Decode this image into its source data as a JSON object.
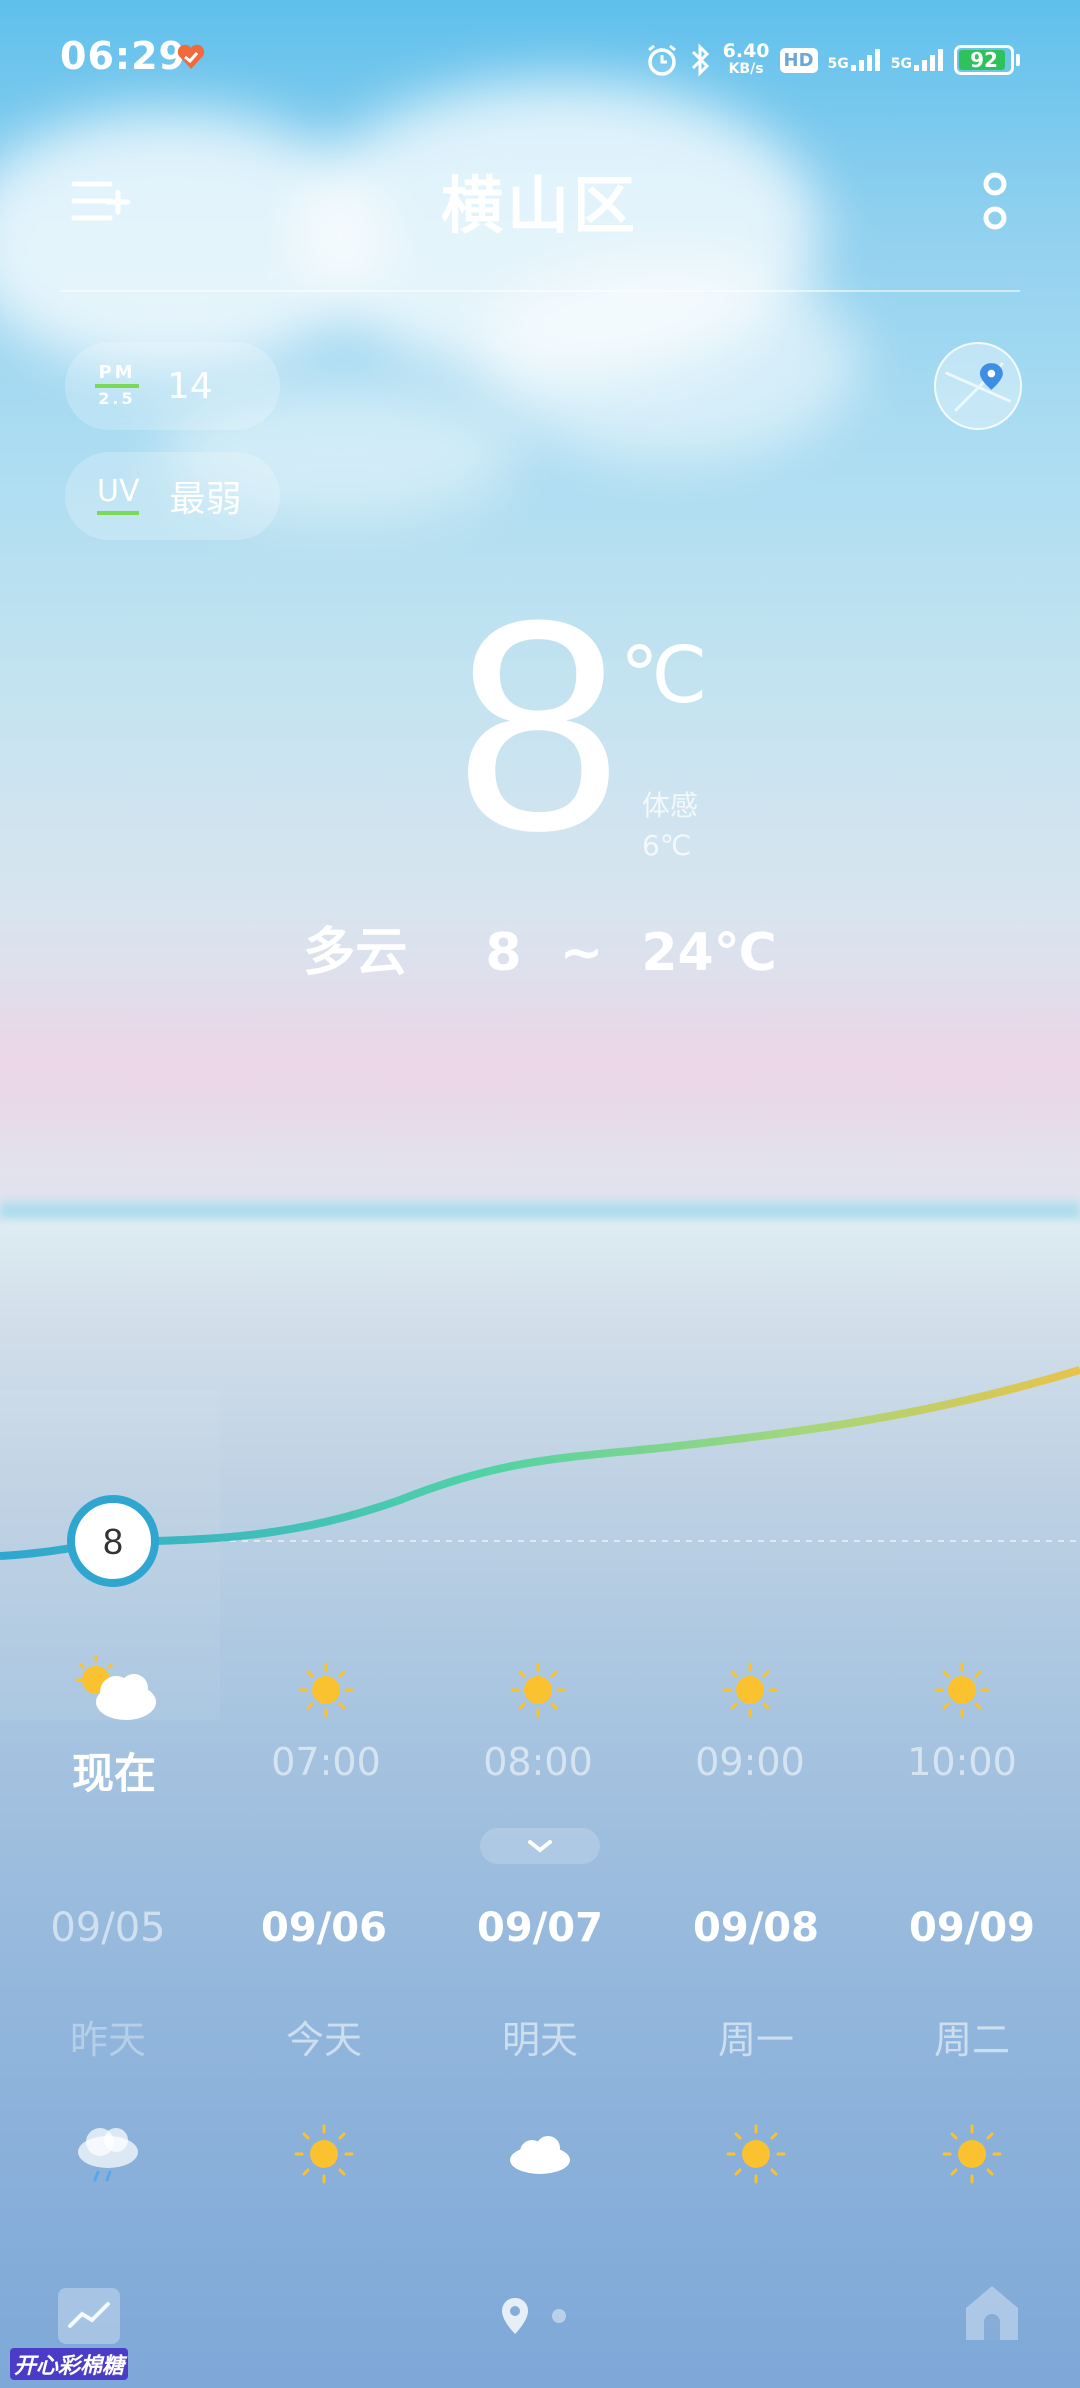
{
  "status_bar": {
    "time": "06:29",
    "net_speed_value": "6.40",
    "net_speed_unit": "KB/s",
    "hd_label": "HD",
    "sim1_label": "5G",
    "sim2_label": "5G",
    "battery": "92",
    "battery_level": 0.92,
    "battery_color": "#2fc25b"
  },
  "header": {
    "city": "横山区",
    "menu_icon": "menu-add-icon",
    "more_icon": "more-vertical-icon",
    "location_icon": "map-location-icon"
  },
  "air": {
    "pm_label_top": "PM",
    "pm_label_bottom": "2.5",
    "pm_value": "14",
    "uv_label": "UV",
    "uv_value": "最弱",
    "indicator_color": "#7bd957"
  },
  "current": {
    "temp": "8",
    "unit": "℃",
    "feels_label": "体感",
    "feels_value": "6℃",
    "condition": "多云",
    "range": "8 ~ 24℃"
  },
  "hourly": {
    "now_temp": "8",
    "items": [
      {
        "label": "现在",
        "icon": "partly-cloudy-icon"
      },
      {
        "label": "07:00",
        "icon": "sun-icon"
      },
      {
        "label": "08:00",
        "icon": "sun-icon"
      },
      {
        "label": "09:00",
        "icon": "sun-icon"
      },
      {
        "label": "10:00",
        "icon": "sun-icon"
      }
    ],
    "curve_colors": [
      "#2fa6cf",
      "#4fd3a6",
      "#e8c34a"
    ]
  },
  "expand_icon": "chevron-down-icon",
  "daily": [
    {
      "date": "09/05",
      "name": "昨天",
      "icon": "rain-cloud-icon"
    },
    {
      "date": "09/06",
      "name": "今天",
      "icon": "sun-icon"
    },
    {
      "date": "09/07",
      "name": "明天",
      "icon": "cloud-icon"
    },
    {
      "date": "09/08",
      "name": "周一",
      "icon": "sun-icon"
    },
    {
      "date": "09/09",
      "name": "周二",
      "icon": "sun-icon"
    }
  ],
  "bottom_nav": {
    "trend_icon": "trend-chart-icon",
    "location_icon": "location-pin-icon",
    "home_icon": "home-icon"
  },
  "watermark": "开心彩棉糖"
}
